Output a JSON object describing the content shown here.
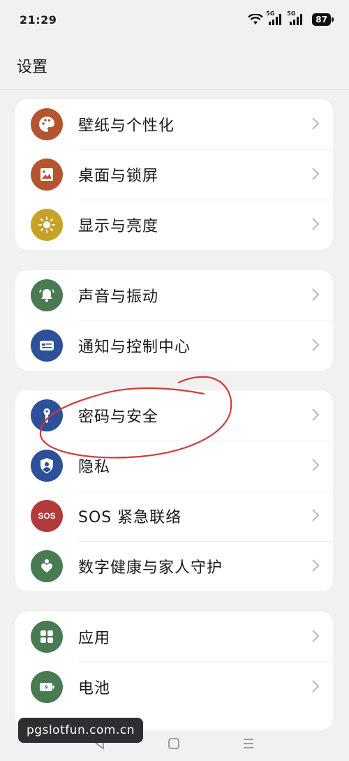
{
  "status_bar": {
    "time": "21:29",
    "network_tag_1": "5G",
    "network_tag_2": "5G",
    "battery": "87"
  },
  "header": {
    "title": "设置"
  },
  "groups": [
    {
      "items": [
        {
          "label": "壁纸与个性化",
          "icon": "palette-icon",
          "color": "#b4552f"
        },
        {
          "label": "桌面与锁屏",
          "icon": "picture-frame-icon",
          "color": "#b4552f"
        },
        {
          "label": "显示与亮度",
          "icon": "sun-icon",
          "color": "#c7a227"
        }
      ]
    },
    {
      "items": [
        {
          "label": "声音与振动",
          "icon": "bell-icon",
          "color": "#4a7a52"
        },
        {
          "label": "通知与控制中心",
          "icon": "notification-card-icon",
          "color": "#2e4f9a"
        }
      ]
    },
    {
      "items": [
        {
          "label": "密码与安全",
          "icon": "key-icon",
          "color": "#2e4f9a"
        },
        {
          "label": "隐私",
          "icon": "shield-user-icon",
          "color": "#2e4f9a"
        },
        {
          "label": "SOS 紧急联络",
          "icon": "sos-icon",
          "icon_text": "SOS",
          "color": "#b23a3a"
        },
        {
          "label": "数字健康与家人守护",
          "icon": "heart-hand-icon",
          "color": "#4a7a52"
        }
      ]
    },
    {
      "items": [
        {
          "label": "应用",
          "icon": "apps-grid-icon",
          "color": "#4a7a52"
        },
        {
          "label": "电池",
          "icon": "battery-icon",
          "color": "#4a7a52"
        }
      ]
    }
  ],
  "watermark": "pgslotfun.com.cn",
  "annotation_color": "#d23b3b"
}
